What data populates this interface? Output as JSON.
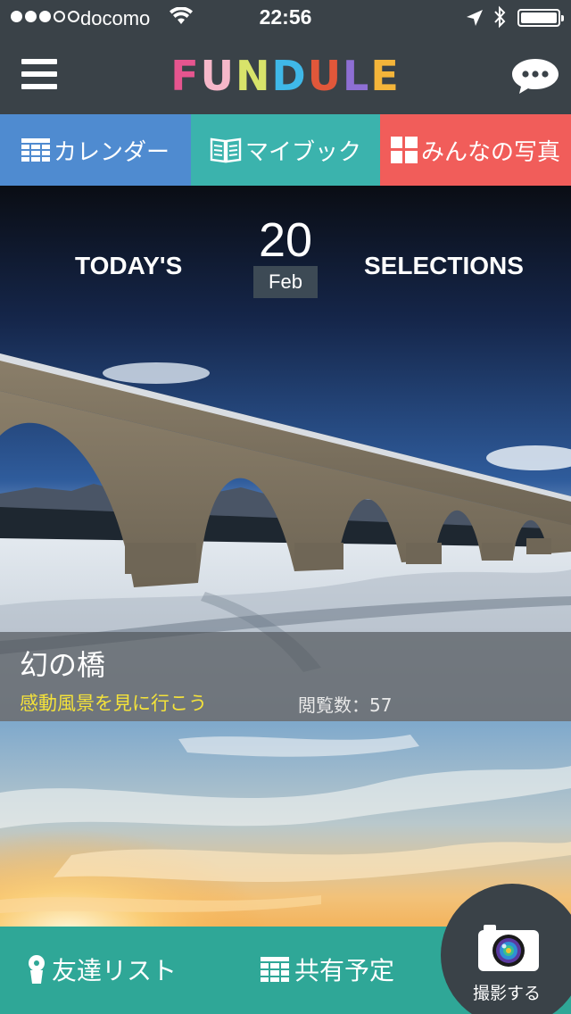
{
  "status_bar": {
    "carrier": "docomo",
    "time": "22:56",
    "signal_bars_filled": 3,
    "signal_bars_total": 5
  },
  "header": {
    "logo_letters": [
      "F",
      "U",
      "N",
      "D",
      "U",
      "L",
      "E"
    ]
  },
  "tabs": [
    {
      "label": "カレンダー",
      "icon": "calendar-grid-icon",
      "color": "#4f8bd0"
    },
    {
      "label": "マイブック",
      "icon": "book-icon",
      "color": "#3bb3ad"
    },
    {
      "label": "みんなの写真",
      "icon": "photo-grid-icon",
      "color": "#f15d5a"
    }
  ],
  "feature": {
    "left_text": "TODAY'S",
    "right_text": "SELECTIONS",
    "day": "20",
    "month": "Feb",
    "title": "幻の橋",
    "subtitle": "感動風景を見に行こう",
    "views": "閲覧数：57",
    "subtitle_color": "#f4e23a"
  },
  "bottom_bar": {
    "friends_label": "友達リスト",
    "shared_label": "共有予定",
    "camera_label": "撮影する",
    "color": "#2fa797"
  }
}
